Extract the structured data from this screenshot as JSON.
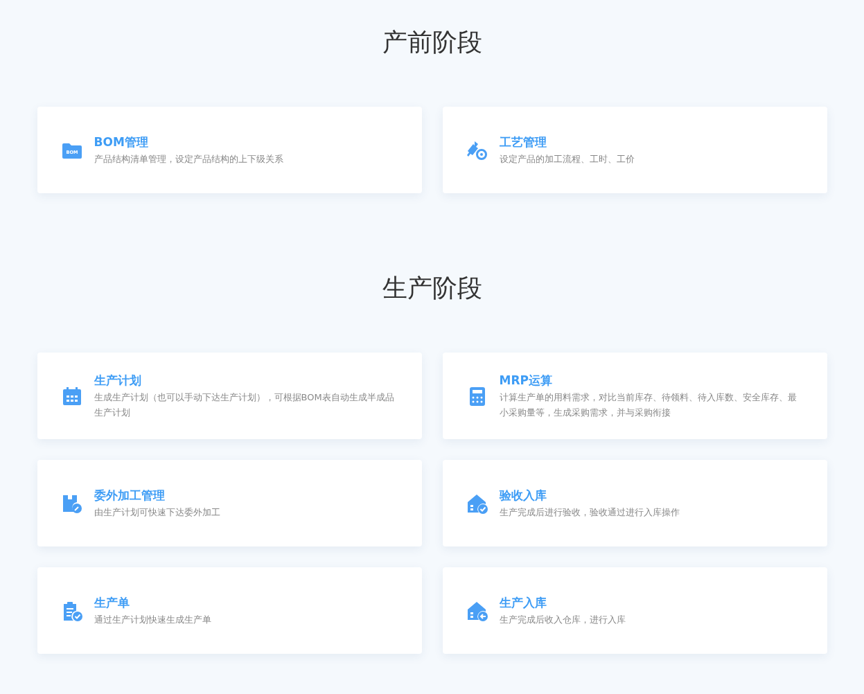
{
  "sections": [
    {
      "title": "产前阶段",
      "cards": [
        {
          "icon_label": "BOM",
          "title": "BOM管理",
          "description": "产品结构清单管理，设定产品结构的上下级关系"
        },
        {
          "title": "工艺管理",
          "description": "设定产品的加工流程、工时、工价"
        }
      ]
    },
    {
      "title": "生产阶段",
      "cards": [
        {
          "title": "生产计划",
          "description": "生成生产计划（也可以手动下达生产计划），可根据BOM表自动生成半成品生产计划"
        },
        {
          "title": "MRP运算",
          "description": "计算生产单的用料需求，对比当前库存、待领料、待入库数、安全库存、最小采购量等，生成采购需求，并与采购衔接"
        },
        {
          "title": "委外加工管理",
          "description": "由生产计划可快速下达委外加工"
        },
        {
          "title": "验收入库",
          "description": "生产完成后进行验收，验收通过进行入库操作"
        },
        {
          "title": "生产单",
          "description": "通过生产计划快速生成生产单"
        },
        {
          "title": "生产入库",
          "description": "生产完成后收入仓库，进行入库"
        }
      ]
    }
  ]
}
